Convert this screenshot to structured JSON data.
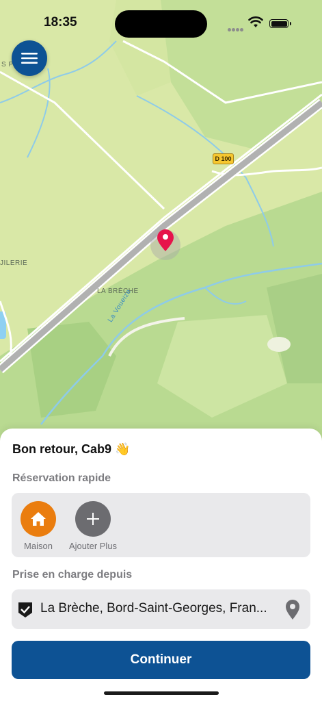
{
  "status": {
    "time": "18:35"
  },
  "map": {
    "labels": {
      "top_left": "S PI",
      "left": "JILERIE",
      "place": "LA BRÈCHE",
      "river": "La Voueize",
      "road": "D 100"
    }
  },
  "sheet": {
    "greeting": "Bon retour, Cab9 👋",
    "quick_title": "Réservation rapide",
    "quick_items": [
      {
        "label": "Maison",
        "icon": "home-icon",
        "color": "#ea7d0f"
      },
      {
        "label": "Ajouter Plus",
        "icon": "plus-icon",
        "color": "#6c6c70"
      }
    ],
    "pickup_title": "Prise en charge depuis",
    "pickup_value": "La Brèche, Bord-Saint-Georges, Fran...",
    "continue_label": "Continuer"
  },
  "colors": {
    "brand": "#0d5294",
    "pin": "#e6144b",
    "home": "#ea7d0f"
  }
}
